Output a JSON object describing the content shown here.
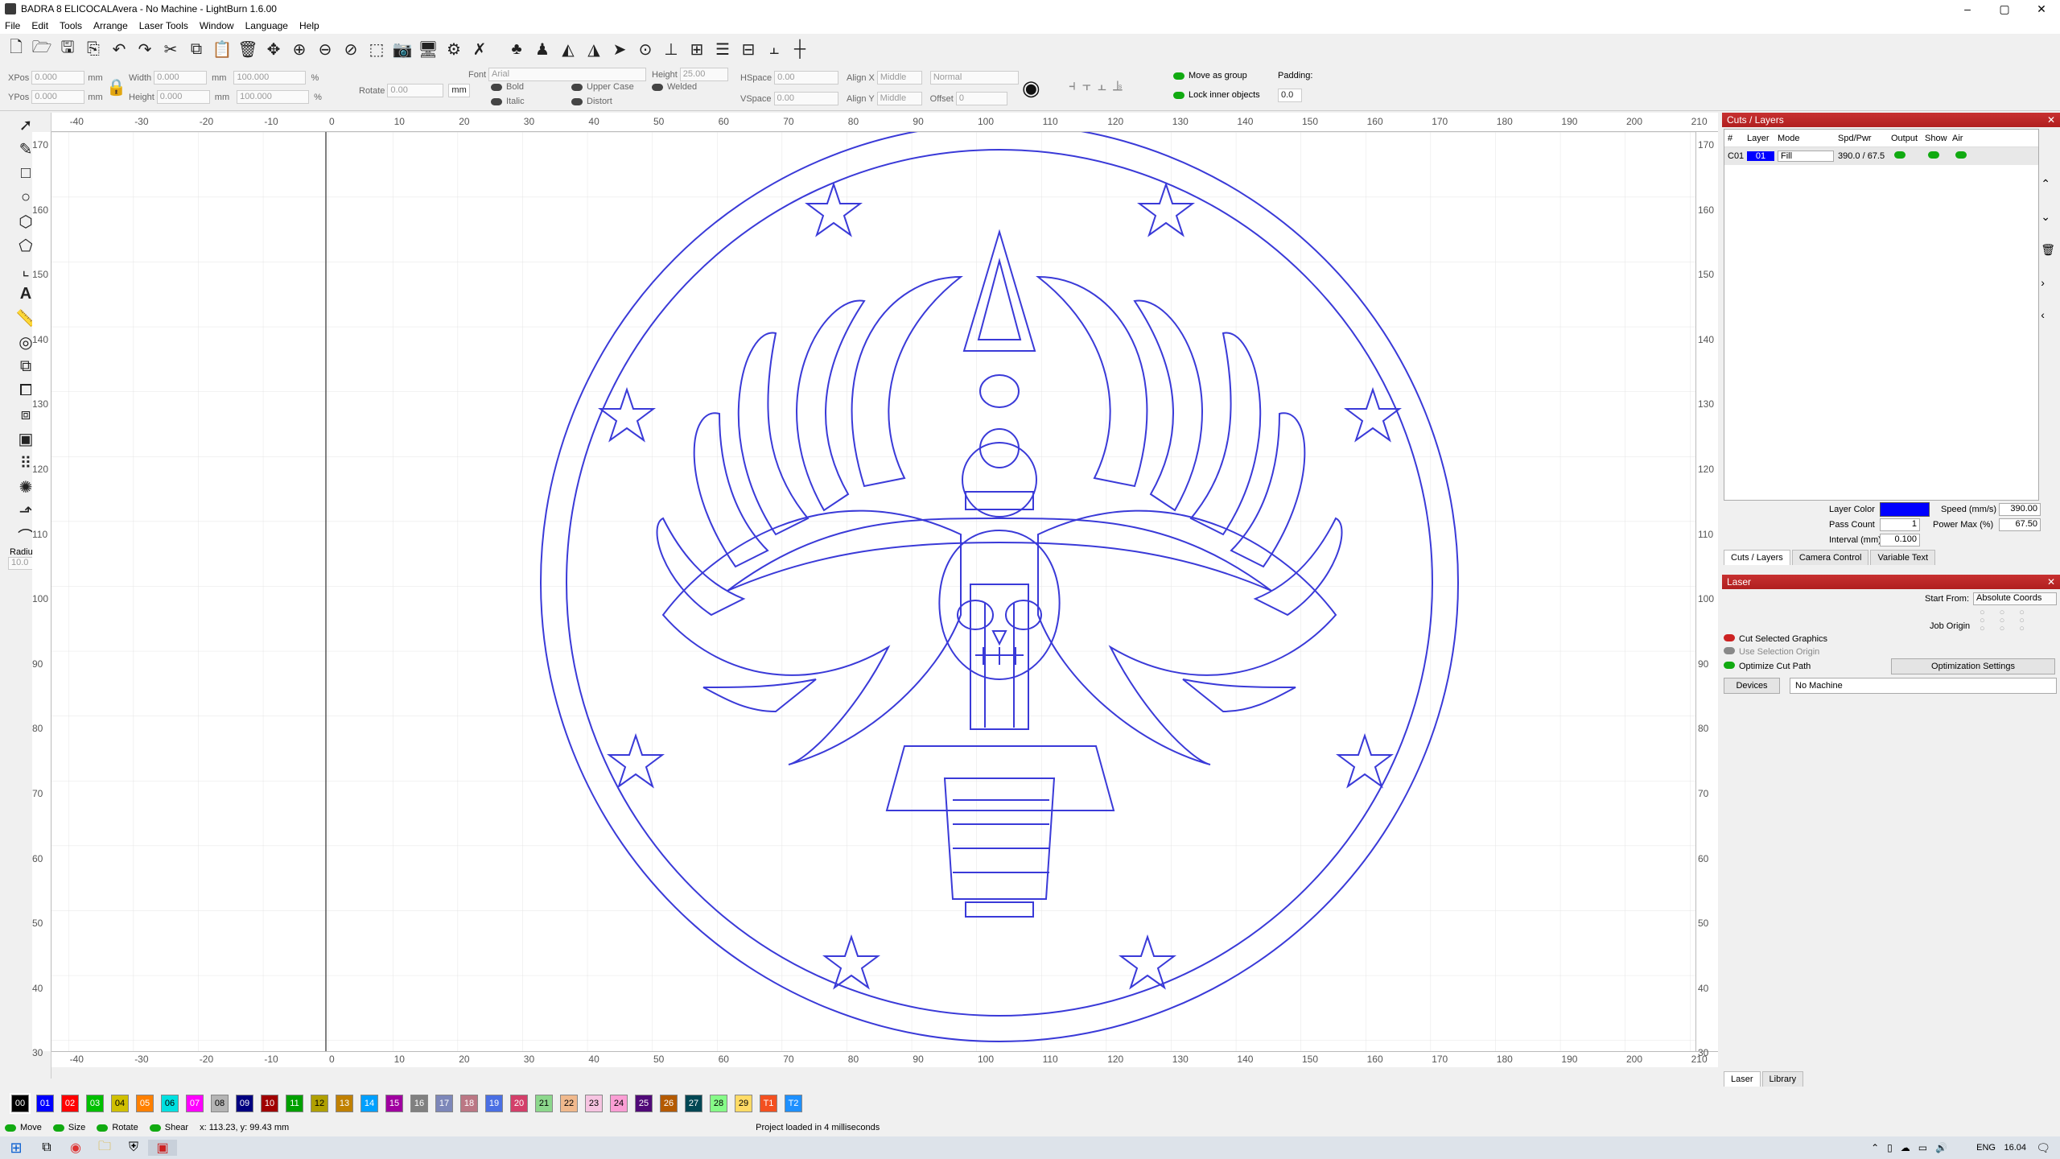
{
  "window": {
    "title": "BADRA 8 ELICOCALAvera - No Machine - LightBurn 1.6.00",
    "min": "–",
    "max": "▢",
    "close": "✕"
  },
  "menu": [
    "File",
    "Edit",
    "Tools",
    "Arrange",
    "Laser Tools",
    "Window",
    "Language",
    "Help"
  ],
  "toolbar_icons": [
    "new-file-icon",
    "open-file-icon",
    "save-icon",
    "save-as-icon",
    "undo-icon",
    "redo-icon",
    "cut-icon",
    "copy-icon",
    "paste-icon",
    "delete-icon",
    "move-icon",
    "zoom-in-icon",
    "zoom-out-icon",
    "zoom-fit-icon",
    "zoom-selection-icon",
    "camera-icon",
    "monitor-icon",
    "settings-icon",
    "tools-icon",
    "group-icon",
    "user-icon",
    "mirror-h-icon",
    "mirror-v-icon",
    "send-icon",
    "center-icon",
    "align-icon",
    "align-center-icon",
    "distribute-icon",
    "dock-icon",
    "dock2-icon",
    "crosshair-icon"
  ],
  "props": {
    "xpos_label": "XPos",
    "xpos": "0.000",
    "ypos_label": "YPos",
    "ypos": "0.000",
    "unit": "mm",
    "width_label": "Width",
    "width": "0.000",
    "height_label": "Height",
    "height": "0.000",
    "wpct": "100.000",
    "hpct": "100.000",
    "pct": "%",
    "rotate_label": "Rotate",
    "rotate": "0.00",
    "mm_btn": "mm",
    "font_label": "Font",
    "font": "Arial",
    "fheight_label": "Height",
    "fheight": "25.00",
    "hspace_label": "HSpace",
    "hspace": "0.00",
    "vspace_label": "VSpace",
    "vspace": "0.00",
    "alignx_label": "Align X",
    "alignx": "Middle",
    "aligny_label": "Align Y",
    "aligny": "Middle",
    "normal": "Normal",
    "offset_label": "Offset",
    "offset": "0",
    "bold": "Bold",
    "italic": "Italic",
    "upper": "Upper Case",
    "distort": "Distort",
    "welded": "Welded",
    "move_group": "Move as group",
    "lock_inner": "Lock inner objects",
    "padding_label": "Padding:",
    "padding": "0.0"
  },
  "left_tools": [
    "select-icon",
    "pen-icon",
    "rectangle-icon",
    "ellipse-icon",
    "polygon-icon",
    "polyline-icon",
    "node-edit-icon",
    "text-icon",
    "measure-icon",
    "offset-icon",
    "boolean-union-icon",
    "boolean-subtract-icon",
    "boolean-intersect-icon",
    "weld-icon",
    "array-icon",
    "circular-array-icon",
    "corner-icon",
    "fillet-icon"
  ],
  "radius": {
    "label": "Radius:",
    "value": "10.0"
  },
  "ruler_x": [
    "-40",
    "-30",
    "-20",
    "-10",
    "0",
    "10",
    "20",
    "30",
    "40",
    "50",
    "60",
    "70",
    "80",
    "90",
    "100",
    "110",
    "120",
    "130",
    "140",
    "150",
    "160",
    "170",
    "180",
    "190",
    "200",
    "210"
  ],
  "ruler_y": [
    "170",
    "160",
    "150",
    "140",
    "130",
    "120",
    "110",
    "100",
    "90",
    "80",
    "70",
    "60",
    "50",
    "40",
    "30"
  ],
  "palette": [
    {
      "l": "00",
      "c": "#000000"
    },
    {
      "l": "01",
      "c": "#0000ff"
    },
    {
      "l": "02",
      "c": "#ff0000"
    },
    {
      "l": "03",
      "c": "#00c000"
    },
    {
      "l": "04",
      "c": "#d0c000"
    },
    {
      "l": "05",
      "c": "#ff8000"
    },
    {
      "l": "06",
      "c": "#00e0e0"
    },
    {
      "l": "07",
      "c": "#ff00ff"
    },
    {
      "l": "08",
      "c": "#b4b4b4"
    },
    {
      "l": "09",
      "c": "#000080"
    },
    {
      "l": "10",
      "c": "#a00000"
    },
    {
      "l": "11",
      "c": "#00a000"
    },
    {
      "l": "12",
      "c": "#b0a000"
    },
    {
      "l": "13",
      "c": "#c08000"
    },
    {
      "l": "14",
      "c": "#00a0ff"
    },
    {
      "l": "15",
      "c": "#a000a0"
    },
    {
      "l": "16",
      "c": "#808080"
    },
    {
      "l": "17",
      "c": "#7d87b9"
    },
    {
      "l": "18",
      "c": "#bb7784"
    },
    {
      "l": "19",
      "c": "#4a6fe3"
    },
    {
      "l": "20",
      "c": "#d33f6a"
    },
    {
      "l": "21",
      "c": "#8cd78c"
    },
    {
      "l": "22",
      "c": "#f0b98d"
    },
    {
      "l": "23",
      "c": "#f6c4e1"
    },
    {
      "l": "24",
      "c": "#fa9ed4"
    },
    {
      "l": "25",
      "c": "#500a78"
    },
    {
      "l": "26",
      "c": "#b45a00"
    },
    {
      "l": "27",
      "c": "#004754"
    },
    {
      "l": "28",
      "c": "#86fa88"
    },
    {
      "l": "29",
      "c": "#ffdb66"
    },
    {
      "l": "T1",
      "c": "#f35020"
    },
    {
      "l": "T2",
      "c": "#1e90ff"
    }
  ],
  "status": {
    "move": "Move",
    "size": "Size",
    "rotate": "Rotate",
    "shear": "Shear",
    "coords": "x: 113.23, y: 99.43 mm",
    "message": "Project loaded in 4 milliseconds"
  },
  "cuts": {
    "title": "Cuts / Layers",
    "headers": [
      "#",
      "Layer",
      "Mode",
      "Spd/Pwr",
      "Output",
      "Show",
      "Air"
    ],
    "row": {
      "id": "C01",
      "layer": "01",
      "mode": "Fill",
      "spdpwr": "390.0 / 67.5"
    },
    "layer_color_label": "Layer Color",
    "pass_count_label": "Pass Count",
    "pass_count": "1",
    "interval_label": "Interval (mm)",
    "interval": "0.100",
    "speed_label": "Speed (mm/s)",
    "speed": "390.00",
    "power_label": "Power Max (%)",
    "power": "67.50",
    "tabs": [
      "Cuts / Layers",
      "Camera Control",
      "Variable Text"
    ]
  },
  "laser": {
    "title": "Laser",
    "start_from_label": "Start From:",
    "start_from": "Absolute Coords",
    "job_origin": "Job Origin",
    "cut_selected": "Cut Selected Graphics",
    "use_selection": "Use Selection Origin",
    "optimize": "Optimize Cut Path",
    "opt_settings": "Optimization Settings",
    "devices": "Devices",
    "machine": "No Machine",
    "tabs": [
      "Laser",
      "Library"
    ]
  },
  "taskbar": {
    "lang": "ENG",
    "time": "16.04"
  },
  "colors": {
    "accent": "#0000ff",
    "panel_header": "#c02828",
    "design": "#3a3ad8"
  }
}
